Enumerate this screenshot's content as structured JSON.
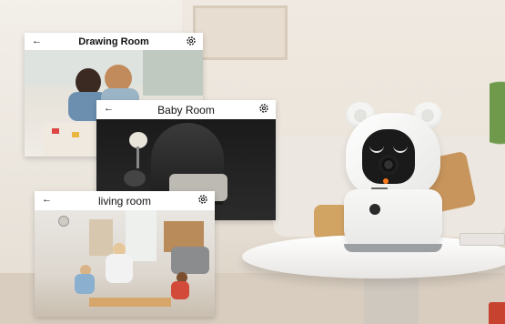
{
  "cameras": [
    {
      "id": "drawing",
      "title": "Drawing Room"
    },
    {
      "id": "baby",
      "title": "Baby Room"
    },
    {
      "id": "living",
      "title": "living room"
    }
  ],
  "icons": {
    "back": "back-arrow-icon",
    "settings": "gear-icon"
  },
  "colors": {
    "camera_indicator": "#ff7a1a"
  }
}
